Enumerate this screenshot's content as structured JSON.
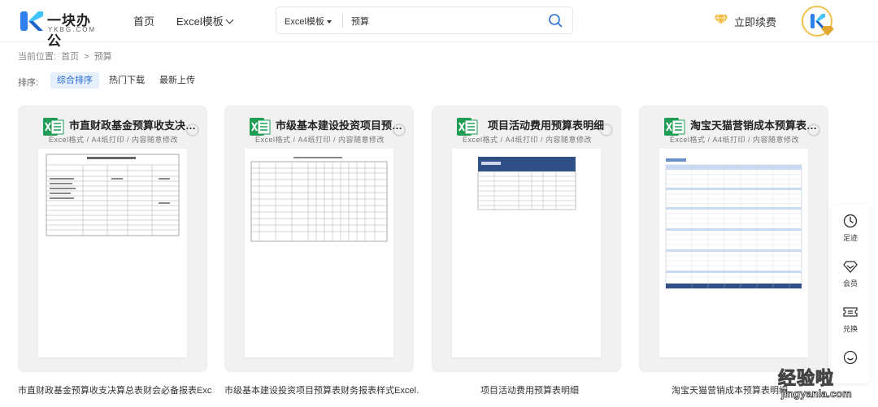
{
  "header": {
    "logo_text": "一块办公",
    "logo_sub": "YKBG.COM",
    "nav": [
      {
        "label": "首页"
      },
      {
        "label": "Excel模板"
      }
    ],
    "search": {
      "category": "Excel模板",
      "value": "预算"
    },
    "renew_label": "立即续费"
  },
  "breadcrumb": {
    "prefix": "当前位置:",
    "home": "首页",
    "separator": ">",
    "current": "预算"
  },
  "sort": {
    "label": "排序:",
    "options": [
      {
        "label": "综合排序",
        "active": true
      },
      {
        "label": "热门下载",
        "active": false
      },
      {
        "label": "最新上传",
        "active": false
      }
    ]
  },
  "cards": [
    {
      "title": "市直财政基金预算收支决…",
      "subtitle": "Excel格式 / A4纸打印 / 内容随意修改",
      "caption": "市直财政基金预算收支决算总表财会必备报表Exc…"
    },
    {
      "title": "市级基本建设投资项目预…",
      "subtitle": "Excel格式 / A4纸打印 / 内容随意修改",
      "caption": "市级基本建设投资项目预算表财务报表样式Excel…"
    },
    {
      "title": "项目活动费用预算表明细",
      "subtitle": "Excel格式 / A4纸打印 / 内容随意修改",
      "caption": "项目活动费用预算表明细"
    },
    {
      "title": "淘宝天猫营销成本预算表…",
      "subtitle": "Excel格式 / A4纸打印 / 内容随意修改",
      "caption": "淘宝天猫营销成本预算表明细"
    }
  ],
  "side_tools": [
    {
      "label": "足迹",
      "icon": "clock-icon"
    },
    {
      "label": "会员",
      "icon": "diamond-icon"
    },
    {
      "label": "兑换",
      "icon": "ticket-icon"
    },
    {
      "label": "",
      "icon": "smile-icon"
    }
  ],
  "watermark": {
    "main": "经验啦",
    "sub": "jingyanla.com"
  },
  "colors": {
    "accent": "#2a6fd6",
    "excel_green": "#1f9d55",
    "gold": "#f0c24a",
    "card_bg": "#f1f1f2"
  }
}
